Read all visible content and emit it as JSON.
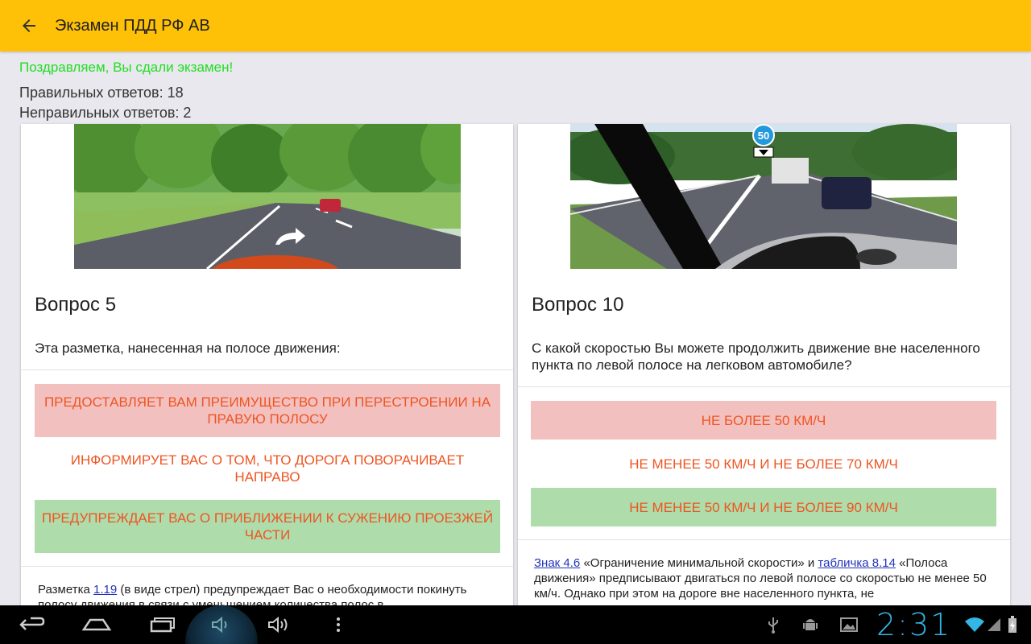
{
  "appbar": {
    "title": "Экзамен ПДД РФ АВ",
    "back_icon": "arrow-back-icon",
    "bg": "#ffc107"
  },
  "result": {
    "congrats": "Поздравляем, Вы сдали экзамен!",
    "correct": "Правильных ответов: 18",
    "wrong": "Неправильных ответов: 2"
  },
  "cards": [
    {
      "title": "Вопрос 5",
      "question": "Эта разметка, нанесенная на полосе движения:",
      "answers": [
        {
          "text": "Предоставляет Вам преимущество при перестроении на правую полосу",
          "state": "wrong"
        },
        {
          "text": "Информирует Вас о том, что дорога поворачивает направо",
          "state": "none"
        },
        {
          "text": "Предупреждает Вас о приближении к сужению проезжей части",
          "state": "correct"
        }
      ],
      "explanation": {
        "p1": "Разметка ",
        "link1": "1.19",
        "p2": " (в виде стрел) предупреждает Вас о необходимости покинуть полосу движения в связи с уменьшением количества полос в"
      }
    },
    {
      "title": "Вопрос 10",
      "question": "С какой скоростью Вы можете продолжить движение вне населенного пункта по левой полосе на легковом автомобиле?",
      "sign_label": "50",
      "answers": [
        {
          "text": "Не более 50 км/ч",
          "state": "wrong"
        },
        {
          "text": "Не менее 50 км/ч и не более 70 км/ч",
          "state": "none"
        },
        {
          "text": "Не менее 50 км/ч и не более 90 км/ч",
          "state": "correct"
        }
      ],
      "explanation": {
        "link1": "Знак 4.6",
        "p1": " «Ограничение минимальной скорости» и ",
        "link2": "табличка 8.14",
        "p2": " «Полоса движения» предписывают двигаться по левой полосе со скоростью не менее 50 км/ч. Однако при этом на дороге вне населенного пункта, не"
      }
    }
  ],
  "navbar": {
    "icons": [
      "back-icon",
      "home-icon",
      "recent-apps-icon",
      "volume-down-icon",
      "volume-up-icon",
      "menu-icon"
    ],
    "status_icons": [
      "usb-icon",
      "android-debug-icon",
      "image-icon",
      "wifi-icon",
      "signal-icon",
      "battery-icon"
    ],
    "time": "2:31"
  },
  "colors": {
    "accent": "#ffc107",
    "success_text": "#22dd22",
    "answer_text": "#ee5522",
    "wrong_bg": "#f3c0c0",
    "correct_bg": "#aedcaa",
    "clock": "#33b5e5"
  }
}
